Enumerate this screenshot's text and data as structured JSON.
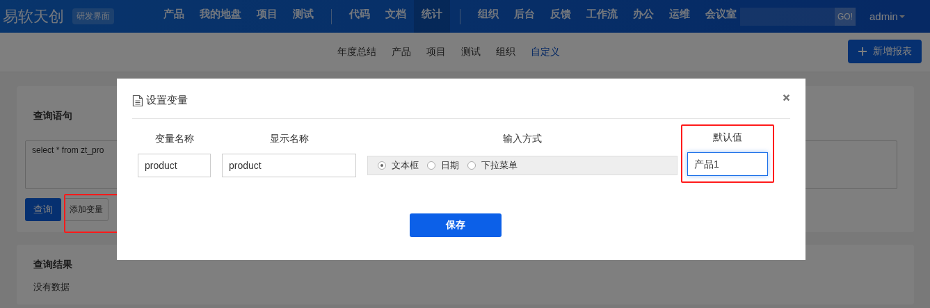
{
  "header": {
    "logo": "易软天创",
    "badge": "研发界面",
    "nav": [
      {
        "label": "产品",
        "selected": false,
        "divider_after": false
      },
      {
        "label": "我的地盘",
        "selected": false,
        "divider_after": false
      },
      {
        "label": "项目",
        "selected": false,
        "divider_after": false
      },
      {
        "label": "测试",
        "selected": false,
        "divider_after": true
      },
      {
        "label": "代码",
        "selected": false,
        "divider_after": false
      },
      {
        "label": "文档",
        "selected": false,
        "divider_after": false
      },
      {
        "label": "统计",
        "selected": true,
        "divider_after": true
      },
      {
        "label": "组织",
        "selected": false,
        "divider_after": false
      },
      {
        "label": "后台",
        "selected": false,
        "divider_after": false
      },
      {
        "label": "反馈",
        "selected": false,
        "divider_after": false
      },
      {
        "label": "工作流",
        "selected": false,
        "divider_after": false
      },
      {
        "label": "办公",
        "selected": false,
        "divider_after": false
      },
      {
        "label": "运维",
        "selected": false,
        "divider_after": false
      },
      {
        "label": "会议室",
        "selected": false,
        "divider_after": false
      }
    ],
    "search_button": "GO!",
    "user": "admin"
  },
  "subnav": {
    "items": [
      {
        "label": "年度总结",
        "selected": false
      },
      {
        "label": "产品",
        "selected": false
      },
      {
        "label": "项目",
        "selected": false
      },
      {
        "label": "测试",
        "selected": false
      },
      {
        "label": "组织",
        "selected": false
      },
      {
        "label": "自定义",
        "selected": true
      }
    ],
    "add_button": "新增报表"
  },
  "query_panel": {
    "title": "查询语句",
    "sql": "select * from zt_pro",
    "query_button": "查询",
    "add_variable_button": {
      "label": "添加变量",
      "highlighted": true
    }
  },
  "result_panel": {
    "title": "查询结果",
    "empty_text": "没有数据"
  },
  "dialog": {
    "title": "设置变量",
    "columns": [
      "变量名称",
      "显示名称",
      "输入方式",
      "默认值"
    ],
    "variable_name": "product",
    "display_name": "product",
    "input_modes": [
      {
        "label": "文本框",
        "selected": true
      },
      {
        "label": "日期",
        "selected": false
      },
      {
        "label": "下拉菜单",
        "selected": false
      }
    ],
    "default_value": {
      "value": "产品1",
      "focused": true,
      "highlighted": true
    },
    "save_button": "保存"
  }
}
